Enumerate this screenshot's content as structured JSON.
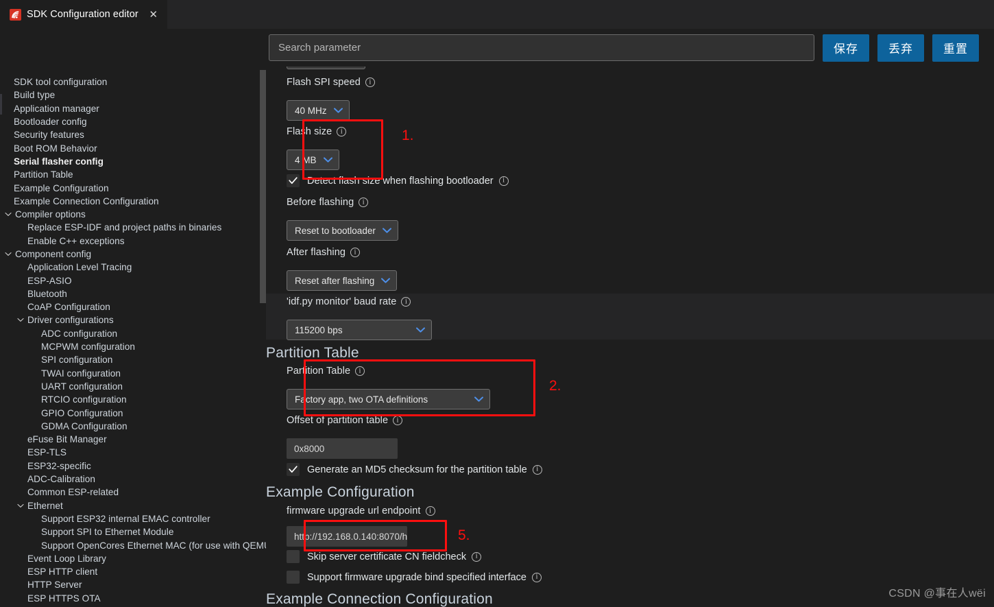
{
  "tab": {
    "title": "SDK Configuration editor",
    "close_label": "✕",
    "icon": "espressif-logo-icon"
  },
  "toolbar": {
    "search_placeholder": "Search parameter",
    "search_value": "",
    "save_label": "保存",
    "discard_label": "丢弃",
    "reset_label": "重置",
    "accent_color": "#0e639c"
  },
  "sidebar": {
    "items": [
      {
        "label": "SDK tool configuration",
        "level": 0,
        "twisty": "none",
        "selected": false
      },
      {
        "label": "Build type",
        "level": 0,
        "twisty": "none",
        "selected": false
      },
      {
        "label": "Application manager",
        "level": 0,
        "twisty": "none",
        "selected": false
      },
      {
        "label": "Bootloader config",
        "level": 0,
        "twisty": "none",
        "selected": false
      },
      {
        "label": "Security features",
        "level": 0,
        "twisty": "none",
        "selected": false
      },
      {
        "label": "Boot ROM Behavior",
        "level": 0,
        "twisty": "none",
        "selected": false
      },
      {
        "label": "Serial flasher config",
        "level": 0,
        "twisty": "none",
        "selected": true
      },
      {
        "label": "Partition Table",
        "level": 0,
        "twisty": "none",
        "selected": false
      },
      {
        "label": "Example Configuration",
        "level": 0,
        "twisty": "none",
        "selected": false
      },
      {
        "label": "Example Connection Configuration",
        "level": 0,
        "twisty": "none",
        "selected": false
      },
      {
        "label": "Compiler options",
        "level": 1,
        "twisty": "expanded",
        "selected": false
      },
      {
        "label": "Replace ESP-IDF and project paths in binaries",
        "level": 2,
        "twisty": "none",
        "selected": false
      },
      {
        "label": "Enable C++ exceptions",
        "level": 2,
        "twisty": "none",
        "selected": false
      },
      {
        "label": "Component config",
        "level": 1,
        "twisty": "expanded",
        "selected": false
      },
      {
        "label": "Application Level Tracing",
        "level": 2,
        "twisty": "none",
        "selected": false
      },
      {
        "label": "ESP-ASIO",
        "level": 2,
        "twisty": "none",
        "selected": false
      },
      {
        "label": "Bluetooth",
        "level": 2,
        "twisty": "none",
        "selected": false
      },
      {
        "label": "CoAP Configuration",
        "level": 2,
        "twisty": "none",
        "selected": false
      },
      {
        "label": "Driver configurations",
        "level": 2,
        "twisty": "expanded",
        "selected": false
      },
      {
        "label": "ADC configuration",
        "level": 3,
        "twisty": "none",
        "selected": false
      },
      {
        "label": "MCPWM configuration",
        "level": 3,
        "twisty": "none",
        "selected": false
      },
      {
        "label": "SPI configuration",
        "level": 3,
        "twisty": "none",
        "selected": false
      },
      {
        "label": "TWAI configuration",
        "level": 3,
        "twisty": "none",
        "selected": false
      },
      {
        "label": "UART configuration",
        "level": 3,
        "twisty": "none",
        "selected": false
      },
      {
        "label": "RTCIO configuration",
        "level": 3,
        "twisty": "none",
        "selected": false
      },
      {
        "label": "GPIO Configuration",
        "level": 3,
        "twisty": "none",
        "selected": false
      },
      {
        "label": "GDMA Configuration",
        "level": 3,
        "twisty": "none",
        "selected": false
      },
      {
        "label": "eFuse Bit Manager",
        "level": 2,
        "twisty": "none",
        "selected": false
      },
      {
        "label": "ESP-TLS",
        "level": 2,
        "twisty": "none",
        "selected": false
      },
      {
        "label": "ESP32-specific",
        "level": 2,
        "twisty": "none",
        "selected": false
      },
      {
        "label": "ADC-Calibration",
        "level": 2,
        "twisty": "none",
        "selected": false
      },
      {
        "label": "Common ESP-related",
        "level": 2,
        "twisty": "none",
        "selected": false
      },
      {
        "label": "Ethernet",
        "level": 2,
        "twisty": "expanded",
        "selected": false
      },
      {
        "label": "Support ESP32 internal EMAC controller",
        "level": 3,
        "twisty": "none",
        "selected": false
      },
      {
        "label": "Support SPI to Ethernet Module",
        "level": 3,
        "twisty": "none",
        "selected": false
      },
      {
        "label": "Support OpenCores Ethernet MAC (for use with QEMU)",
        "level": 3,
        "twisty": "none",
        "selected": false
      },
      {
        "label": "Event Loop Library",
        "level": 2,
        "twisty": "none",
        "selected": false
      },
      {
        "label": "ESP HTTP client",
        "level": 2,
        "twisty": "none",
        "selected": false
      },
      {
        "label": "HTTP Server",
        "level": 2,
        "twisty": "none",
        "selected": false
      },
      {
        "label": "ESP HTTPS OTA",
        "level": 2,
        "twisty": "none",
        "selected": false
      }
    ]
  },
  "main": {
    "fields": {
      "flash_spi_speed_label": "Flash SPI speed",
      "flash_spi_speed_value": "40 MHz",
      "flash_size_label": "Flash size",
      "flash_size_value": "4 MB",
      "detect_flash_size_label": "Detect flash size when flashing bootloader",
      "detect_flash_size_checked": true,
      "before_flashing_label": "Before flashing",
      "before_flashing_value": "Reset to bootloader",
      "after_flashing_label": "After flashing",
      "after_flashing_value": "Reset after flashing",
      "baud_rate_label": "'idf.py monitor' baud rate",
      "baud_rate_value": "115200 bps",
      "partition_table_section": "Partition Table",
      "partition_table_label": "Partition Table",
      "partition_table_value": "Factory app, two OTA definitions",
      "offset_label": "Offset of partition table",
      "offset_value": "0x8000",
      "md5_label": "Generate an MD5 checksum for the partition table",
      "md5_checked": true,
      "example_config_section": "Example Configuration",
      "firmware_url_label": "firmware upgrade url endpoint",
      "firmware_url_value": "http://192.168.0.140:8070/h",
      "skip_cert_label": "Skip server certificate CN fieldcheck",
      "skip_cert_checked": false,
      "bind_iface_label": "Support firmware upgrade bind specified interface",
      "bind_iface_checked": false,
      "example_conn_section": "Example Connection Configuration"
    }
  },
  "annotations": {
    "color": "#fd0f0f",
    "markers": [
      {
        "id": "1",
        "text": "1."
      },
      {
        "id": "2",
        "text": "2."
      },
      {
        "id": "5",
        "text": "5."
      }
    ]
  },
  "watermark": {
    "text": "CSDN @事在人wëi"
  }
}
